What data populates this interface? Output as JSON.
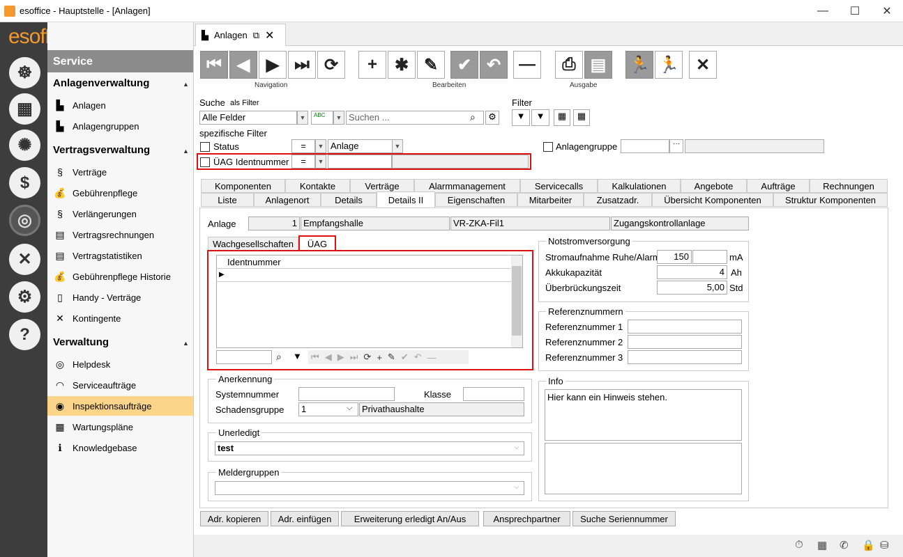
{
  "window": {
    "title": "esoffice - Hauptstelle - [Anlagen]",
    "min": "—",
    "max": "☐",
    "close": "✕"
  },
  "logo": {
    "es": "es",
    "office": "office"
  },
  "sidebar": {
    "header": "Service",
    "groups": [
      {
        "label": "Anlagenverwaltung",
        "items": [
          {
            "label": "Anlagen",
            "icon": "factory-icon"
          },
          {
            "label": "Anlagengruppen",
            "icon": "factory-group-icon"
          }
        ]
      },
      {
        "label": "Vertragsverwaltung",
        "items": [
          {
            "label": "Verträge",
            "icon": "paragraph-icon"
          },
          {
            "label": "Gebührenpflege",
            "icon": "money-bag-icon"
          },
          {
            "label": "Verlängerungen",
            "icon": "paragraph-clock-icon"
          },
          {
            "label": "Vertragsrechnungen",
            "icon": "invoice-icon"
          },
          {
            "label": "Vertragstatistiken",
            "icon": "statistics-icon"
          },
          {
            "label": "Gebührenpflege Historie",
            "icon": "money-bag-history-icon"
          },
          {
            "label": "Handy - Verträge",
            "icon": "phone-icon"
          },
          {
            "label": "Kontingente",
            "icon": "tools-icon"
          }
        ]
      },
      {
        "label": "Verwaltung",
        "items": [
          {
            "label": "Helpdesk",
            "icon": "lifebuoy-icon"
          },
          {
            "label": "Serviceaufträge",
            "icon": "headset-icon"
          },
          {
            "label": "Inspektionsaufträge",
            "icon": "eye-icon"
          },
          {
            "label": "Wartungspläne",
            "icon": "calendar-icon"
          },
          {
            "label": "Knowledgebase",
            "icon": "info-book-icon"
          }
        ]
      }
    ]
  },
  "doc_tab": {
    "label": "Anlagen",
    "popout": "⧉",
    "close": "✕"
  },
  "toolbar": {
    "navigation": "Navigation",
    "bearbeiten": "Bearbeiten",
    "ausgabe": "Ausgabe"
  },
  "search": {
    "label": "Suche",
    "as_filter": "als Filter",
    "fields": "Alle Felder",
    "placeholder": "Suchen ...",
    "filter_label": "Filter"
  },
  "specific": {
    "label": "spezifische Filter",
    "status": "Status",
    "op1": "=",
    "status_val": "Anlage",
    "uag": "ÜAG Identnummer",
    "op2": "=",
    "anlagengruppe": "Anlagengruppe",
    "dots": "···"
  },
  "tabs_row1": [
    "Komponenten",
    "Kontakte",
    "Verträge",
    "Alarmmanagement",
    "Servicecalls",
    "Kalkulationen",
    "Angebote",
    "Aufträge",
    "Rechnungen"
  ],
  "tabs_row2": [
    "Liste",
    "Anlagenort",
    "Details",
    "Details II",
    "Eigenschaften",
    "Mitarbeiter",
    "Zusatzadr.",
    "Übersicht Komponenten",
    "Struktur Komponenten"
  ],
  "anlage": {
    "label": "Anlage",
    "nr": "1",
    "name": "Empfangshalle",
    "code": "VR-ZKA-Fil1",
    "type": "Zugangskontrollanlage"
  },
  "subtabs": [
    "Wachgesellschaften",
    "ÜAG"
  ],
  "grid": {
    "col": "Identnummer"
  },
  "notstrom": {
    "title": "Notstromversorgung",
    "strom_label": "Stromaufnahme Ruhe/Alarm",
    "strom_val": "150",
    "strom_unit": "mA",
    "akku_label": "Akkukapazität",
    "akku_val": "4",
    "akku_unit": "Ah",
    "ueb_label": "Überbrückungszeit",
    "ueb_val": "5,00",
    "ueb_unit": "Std"
  },
  "referenz": {
    "title": "Referenznummern",
    "r1": "Referenznummer 1",
    "r2": "Referenznummer 2",
    "r3": "Referenznummer 3"
  },
  "anerkennung": {
    "title": "Anerkennung",
    "system": "Systemnummer",
    "klasse": "Klasse",
    "schaden": "Schadensgruppe",
    "schaden_val": "1",
    "schaden_text": "Privathaushalte"
  },
  "unerledigt": {
    "title": "Unerledigt",
    "value": "test"
  },
  "meldergruppen": {
    "title": "Meldergruppen"
  },
  "info": {
    "title": "Info",
    "text": "Hier kann ein Hinweis stehen."
  },
  "buttons": [
    "Adr. kopieren",
    "Adr. einfügen",
    "Erweiterung erledigt An/Aus",
    "Ansprechpartner",
    "Suche Seriennummer"
  ]
}
